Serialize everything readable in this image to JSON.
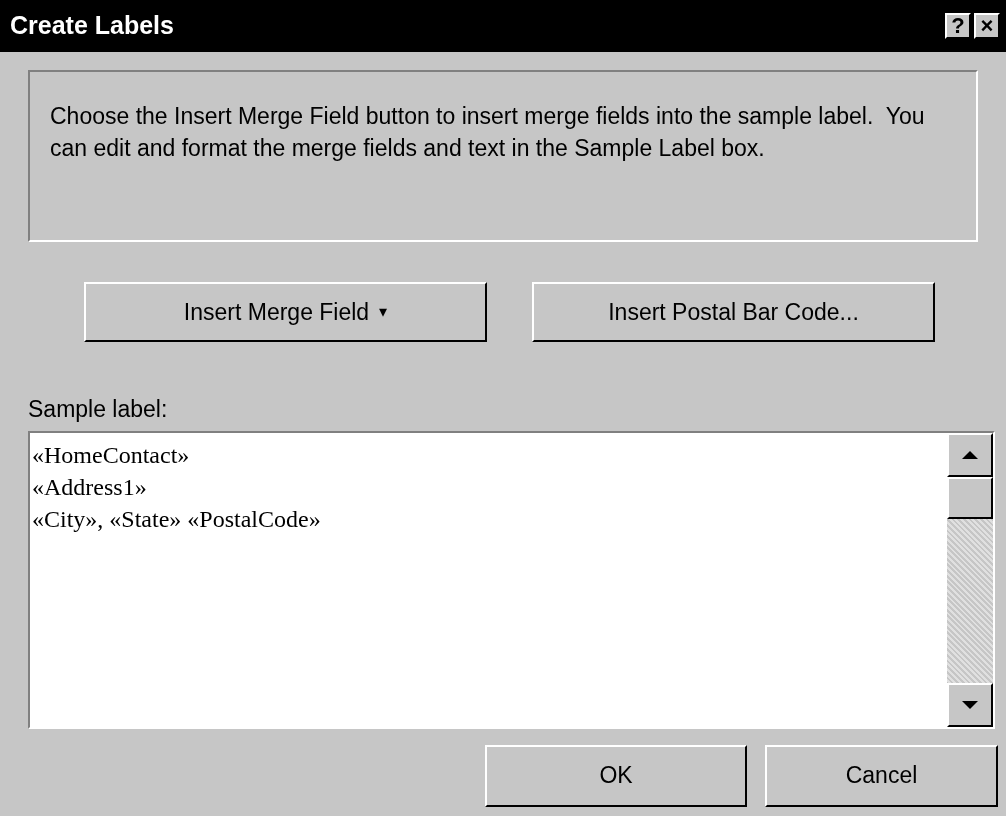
{
  "window": {
    "title": "Create Labels",
    "title_buttons": [
      "?",
      "×"
    ]
  },
  "instructions": "Choose the Insert Merge Field button to insert merge fields into the sample label.  You can edit and format the merge fields and text in the Sample Label box.",
  "buttons": [
    {
      "label": "Insert Merge Field",
      "caret": "▾"
    },
    {
      "label": "Insert Postal Bar Code..."
    }
  ],
  "sample_label": {
    "label": "Sample label:",
    "lines": [
      "«HomeContact»",
      "«Address1»",
      "«City», «State» «PostalCode»"
    ]
  },
  "footer_buttons": [
    "OK",
    "Cancel"
  ]
}
